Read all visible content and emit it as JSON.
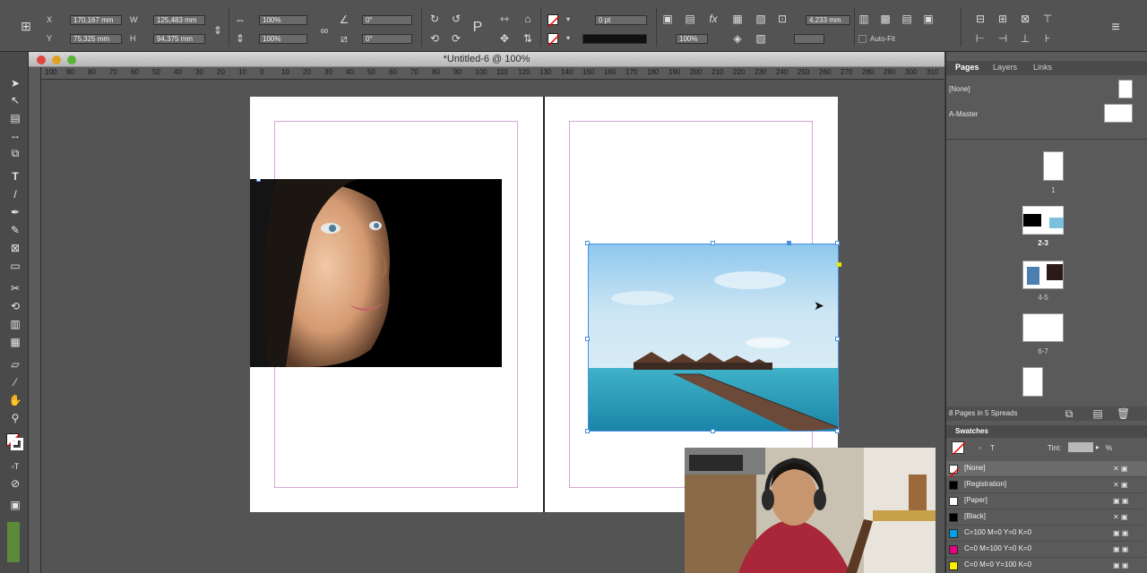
{
  "window": {
    "title": "*Untitled-6 @ 100%"
  },
  "control": {
    "x_label": "X",
    "x_value": "170,167 mm",
    "y_label": "Y",
    "y_value": "75,325 mm",
    "w_label": "W",
    "w_value": "125,483 mm",
    "h_label": "H",
    "h_value": "94,375 mm",
    "scale_x": "100%",
    "scale_y": "100%",
    "angle": "0°",
    "shear": "0°",
    "stroke_weight": "0 pt",
    "opacity": "100%",
    "fitting_value": "4,233 mm",
    "auto_fit_label": "Auto-Fit"
  },
  "ruler": {
    "marks": [
      "100",
      "90",
      "80",
      "70",
      "60",
      "50",
      "40",
      "30",
      "20",
      "10",
      "0",
      "10",
      "20",
      "30",
      "40",
      "50",
      "60",
      "70",
      "80",
      "90",
      "100",
      "110",
      "120",
      "130",
      "140",
      "150",
      "160",
      "170",
      "180",
      "190",
      "200",
      "210",
      "220",
      "230",
      "240",
      "250",
      "260",
      "270",
      "280",
      "290",
      "300",
      "310",
      "320"
    ]
  },
  "panel": {
    "tabs": [
      "Pages",
      "Layers",
      "Links"
    ],
    "none_label": "[None]",
    "master_label": "A-Master",
    "page_labels": [
      "1",
      "2-3",
      "4-5",
      "6-7"
    ],
    "summary": "8 Pages in 5 Spreads",
    "swatches_title": "Swatches",
    "tint_label": "Tint:",
    "tint_unit": "%",
    "swatches": [
      {
        "name": "[None]",
        "color": "#ffffff"
      },
      {
        "name": "[Registration]",
        "color": "#000000"
      },
      {
        "name": "[Paper]",
        "color": "#ffffff"
      },
      {
        "name": "[Black]",
        "color": "#000000"
      },
      {
        "name": "C=100 M=0 Y=0 K=0",
        "color": "#00a0e4"
      },
      {
        "name": "C=0 M=100 Y=0 K=0",
        "color": "#e6007e"
      },
      {
        "name": "C=0 M=0 Y=100 K=0",
        "color": "#ffed00"
      }
    ]
  },
  "colors": {
    "accent": "#4a8fe0",
    "margin": "#d6a5d6"
  }
}
